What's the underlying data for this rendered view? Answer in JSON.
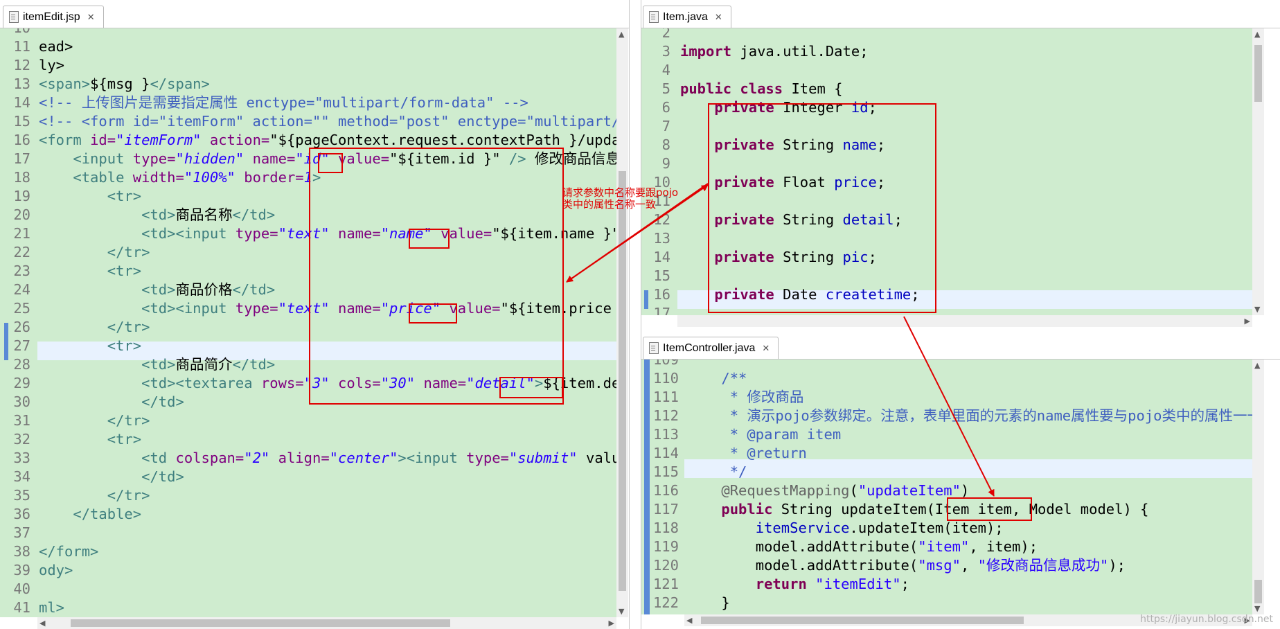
{
  "tabs": {
    "left": "itemEdit.jsp",
    "right_top": "Item.java",
    "right_bottom": "ItemController.java"
  },
  "left_editor": {
    "lines": [
      {
        "n": "10",
        "parts": []
      },
      {
        "n": "11",
        "parts": [
          [
            "pl",
            "ead>"
          ]
        ]
      },
      {
        "n": "12",
        "parts": [
          [
            "pl",
            "ly>"
          ]
        ]
      },
      {
        "n": "13",
        "parts": [
          [
            "tg",
            "<span>"
          ],
          [
            "pl",
            "${msg }"
          ],
          [
            "tg",
            "</span>"
          ]
        ]
      },
      {
        "n": "14",
        "parts": [
          [
            "cm",
            "<!-- 上传图片是需要指定属性 enctype=\"multipart/form-data\" -->"
          ]
        ]
      },
      {
        "n": "15",
        "parts": [
          [
            "cm",
            "<!-- <form id=\"itemForm\" action=\"\" method=\"post\" enctype=\"multipart/form-data\">"
          ]
        ]
      },
      {
        "n": "16",
        "parts": [
          [
            "tg",
            "<form "
          ],
          [
            "at",
            "id="
          ],
          [
            "av",
            "\"itemForm\""
          ],
          [
            "pl",
            " "
          ],
          [
            "at",
            "action="
          ],
          [
            "pl",
            "\"${pageContext.request.contextPath }/updateItem.action\" method=\"post\">"
          ]
        ]
      },
      {
        "n": "17",
        "parts": [
          [
            "pl",
            "    "
          ],
          [
            "tg",
            "<input "
          ],
          [
            "at",
            "type="
          ],
          [
            "av",
            "\"hidden\""
          ],
          [
            "pl",
            " "
          ],
          [
            "at",
            "name="
          ],
          [
            "av",
            "\"id\""
          ],
          [
            "pl",
            " "
          ],
          [
            "at",
            "value="
          ],
          [
            "pl",
            "\"${item.id }\" "
          ],
          [
            "tg",
            "/>"
          ],
          [
            "pl",
            " 修改商品信息："
          ]
        ]
      },
      {
        "n": "18",
        "parts": [
          [
            "pl",
            "    "
          ],
          [
            "tg",
            "<table "
          ],
          [
            "at",
            "width="
          ],
          [
            "av",
            "\"100%\""
          ],
          [
            "pl",
            " "
          ],
          [
            "at",
            "border="
          ],
          [
            "av",
            "1"
          ],
          [
            "tg",
            ">"
          ]
        ]
      },
      {
        "n": "19",
        "parts": [
          [
            "pl",
            "        "
          ],
          [
            "tg",
            "<tr>"
          ]
        ]
      },
      {
        "n": "20",
        "parts": [
          [
            "pl",
            "            "
          ],
          [
            "tg",
            "<td>"
          ],
          [
            "pl",
            "商品名称"
          ],
          [
            "tg",
            "</td>"
          ]
        ]
      },
      {
        "n": "21",
        "parts": [
          [
            "pl",
            "            "
          ],
          [
            "tg",
            "<td><input "
          ],
          [
            "at",
            "type="
          ],
          [
            "av",
            "\"text\""
          ],
          [
            "pl",
            " "
          ],
          [
            "at",
            "name="
          ],
          [
            "av",
            "\"name\""
          ],
          [
            "pl",
            " "
          ],
          [
            "at",
            "value="
          ],
          [
            "pl",
            "\"${item.name }\" /></td>"
          ]
        ]
      },
      {
        "n": "22",
        "parts": [
          [
            "pl",
            "        "
          ],
          [
            "tg",
            "</tr>"
          ]
        ]
      },
      {
        "n": "23",
        "parts": [
          [
            "pl",
            "        "
          ],
          [
            "tg",
            "<tr>"
          ]
        ]
      },
      {
        "n": "24",
        "parts": [
          [
            "pl",
            "            "
          ],
          [
            "tg",
            "<td>"
          ],
          [
            "pl",
            "商品价格"
          ],
          [
            "tg",
            "</td>"
          ]
        ]
      },
      {
        "n": "25",
        "parts": [
          [
            "pl",
            "            "
          ],
          [
            "tg",
            "<td><input "
          ],
          [
            "at",
            "type="
          ],
          [
            "av",
            "\"text\""
          ],
          [
            "pl",
            " "
          ],
          [
            "at",
            "name="
          ],
          [
            "av",
            "\"price\""
          ],
          [
            "pl",
            " "
          ],
          [
            "at",
            "value="
          ],
          [
            "pl",
            "\"${item.price }\" /></td>"
          ]
        ]
      },
      {
        "n": "26",
        "parts": [
          [
            "pl",
            "        "
          ],
          [
            "tg",
            "</tr>"
          ]
        ]
      },
      {
        "n": "27",
        "parts": [
          [
            "pl",
            "        "
          ],
          [
            "tg",
            "<tr>"
          ]
        ]
      },
      {
        "n": "28",
        "parts": [
          [
            "pl",
            "            "
          ],
          [
            "tg",
            "<td>"
          ],
          [
            "pl",
            "商品简介"
          ],
          [
            "tg",
            "</td>"
          ]
        ]
      },
      {
        "n": "29",
        "parts": [
          [
            "pl",
            "            "
          ],
          [
            "tg",
            "<td><textarea "
          ],
          [
            "at",
            "rows="
          ],
          [
            "av",
            "\"3\""
          ],
          [
            "pl",
            " "
          ],
          [
            "at",
            "cols="
          ],
          [
            "av",
            "\"30\""
          ],
          [
            "pl",
            " "
          ],
          [
            "at",
            "name="
          ],
          [
            "av",
            "\"detail\""
          ],
          [
            "tg",
            ">"
          ],
          [
            "pl",
            "${item.detail }</textarea>"
          ]
        ]
      },
      {
        "n": "30",
        "parts": [
          [
            "pl",
            "            "
          ],
          [
            "tg",
            "</td>"
          ]
        ]
      },
      {
        "n": "31",
        "parts": [
          [
            "pl",
            "        "
          ],
          [
            "tg",
            "</tr>"
          ]
        ]
      },
      {
        "n": "32",
        "parts": [
          [
            "pl",
            "        "
          ],
          [
            "tg",
            "<tr>"
          ]
        ]
      },
      {
        "n": "33",
        "parts": [
          [
            "pl",
            "            "
          ],
          [
            "tg",
            "<td "
          ],
          [
            "at",
            "colspan="
          ],
          [
            "av",
            "\"2\""
          ],
          [
            "pl",
            " "
          ],
          [
            "at",
            "align="
          ],
          [
            "av",
            "\"center\""
          ],
          [
            "tg",
            "><input "
          ],
          [
            "at",
            "type="
          ],
          [
            "av",
            "\"submit\""
          ],
          [
            "pl",
            " value=\"提交\" />"
          ]
        ]
      },
      {
        "n": "34",
        "parts": [
          [
            "pl",
            "            "
          ],
          [
            "tg",
            "</td>"
          ]
        ]
      },
      {
        "n": "35",
        "parts": [
          [
            "pl",
            "        "
          ],
          [
            "tg",
            "</tr>"
          ]
        ]
      },
      {
        "n": "36",
        "parts": [
          [
            "pl",
            "    "
          ],
          [
            "tg",
            "</table>"
          ]
        ]
      },
      {
        "n": "37",
        "parts": []
      },
      {
        "n": "38",
        "parts": [
          [
            "tg",
            "</form>"
          ]
        ]
      },
      {
        "n": "39",
        "parts": [
          [
            "tg",
            "ody>"
          ]
        ]
      },
      {
        "n": "40",
        "parts": []
      },
      {
        "n": "41",
        "parts": [
          [
            "tg",
            "ml>"
          ]
        ]
      }
    ]
  },
  "right_top_editor": {
    "lines": [
      {
        "n": "2",
        "parts": []
      },
      {
        "n": "3",
        "parts": [
          [
            "kw",
            "import"
          ],
          [
            "pl",
            " java.util.Date;"
          ]
        ]
      },
      {
        "n": "4",
        "parts": []
      },
      {
        "n": "5",
        "parts": [
          [
            "kw",
            "public"
          ],
          [
            "pl",
            " "
          ],
          [
            "kw",
            "class"
          ],
          [
            "pl",
            " Item {"
          ]
        ]
      },
      {
        "n": "6",
        "parts": [
          [
            "pl",
            "    "
          ],
          [
            "kw",
            "private"
          ],
          [
            "pl",
            " Integer "
          ],
          [
            "fld",
            "id"
          ],
          [
            "pl",
            ";"
          ]
        ]
      },
      {
        "n": "7",
        "parts": []
      },
      {
        "n": "8",
        "parts": [
          [
            "pl",
            "    "
          ],
          [
            "kw",
            "private"
          ],
          [
            "pl",
            " String "
          ],
          [
            "fld",
            "name"
          ],
          [
            "pl",
            ";"
          ]
        ]
      },
      {
        "n": "9",
        "parts": []
      },
      {
        "n": "10",
        "parts": [
          [
            "pl",
            "    "
          ],
          [
            "kw",
            "private"
          ],
          [
            "pl",
            " Float "
          ],
          [
            "fld",
            "price"
          ],
          [
            "pl",
            ";"
          ]
        ]
      },
      {
        "n": "11",
        "parts": []
      },
      {
        "n": "12",
        "parts": [
          [
            "pl",
            "    "
          ],
          [
            "kw",
            "private"
          ],
          [
            "pl",
            " String "
          ],
          [
            "fld",
            "detail"
          ],
          [
            "pl",
            ";"
          ]
        ]
      },
      {
        "n": "13",
        "parts": []
      },
      {
        "n": "14",
        "parts": [
          [
            "pl",
            "    "
          ],
          [
            "kw",
            "private"
          ],
          [
            "pl",
            " String "
          ],
          [
            "fld",
            "pic"
          ],
          [
            "pl",
            ";"
          ]
        ]
      },
      {
        "n": "15",
        "parts": []
      },
      {
        "n": "16",
        "parts": [
          [
            "pl",
            "    "
          ],
          [
            "kw",
            "private"
          ],
          [
            "pl",
            " Date "
          ],
          [
            "fld",
            "createtime"
          ],
          [
            "pl",
            ";"
          ]
        ]
      },
      {
        "n": "17",
        "parts": []
      }
    ]
  },
  "right_bottom_editor": {
    "lines": [
      {
        "n": "109",
        "parts": []
      },
      {
        "n": "110",
        "parts": [
          [
            "cm",
            "    /**"
          ]
        ]
      },
      {
        "n": "111",
        "parts": [
          [
            "cm",
            "     * 修改商品"
          ]
        ]
      },
      {
        "n": "112",
        "parts": [
          [
            "cm",
            "     * 演示pojo参数绑定。注意，表单里面的元素的name属性要与pojo类中的属性一一对应"
          ]
        ]
      },
      {
        "n": "113",
        "parts": [
          [
            "cm",
            "     * @param item"
          ]
        ]
      },
      {
        "n": "114",
        "parts": [
          [
            "cm",
            "     * @return"
          ]
        ]
      },
      {
        "n": "115",
        "parts": [
          [
            "cm",
            "     */"
          ]
        ]
      },
      {
        "n": "116",
        "parts": [
          [
            "ann",
            "    @RequestMapping"
          ],
          [
            "pl",
            "("
          ],
          [
            "st",
            "\"updateItem\""
          ],
          [
            "pl",
            ")"
          ]
        ]
      },
      {
        "n": "117",
        "parts": [
          [
            "pl",
            "    "
          ],
          [
            "kw",
            "public"
          ],
          [
            "pl",
            " String updateItem(Item "
          ],
          [
            "pl",
            "item"
          ],
          [
            "pl",
            ", Model "
          ],
          [
            "pl",
            "model"
          ],
          [
            "pl",
            ") {"
          ]
        ]
      },
      {
        "n": "118",
        "parts": [
          [
            "pl",
            "        "
          ],
          [
            "fld",
            "itemService"
          ],
          [
            "pl",
            ".updateItem(item);"
          ]
        ]
      },
      {
        "n": "119",
        "parts": [
          [
            "pl",
            "        model.addAttribute("
          ],
          [
            "st",
            "\"item\""
          ],
          [
            "pl",
            ", item);"
          ]
        ]
      },
      {
        "n": "120",
        "parts": [
          [
            "pl",
            "        model.addAttribute("
          ],
          [
            "st",
            "\"msg\""
          ],
          [
            "pl",
            ", "
          ],
          [
            "st",
            "\"修改商品信息成功\""
          ],
          [
            "pl",
            ");"
          ]
        ]
      },
      {
        "n": "121",
        "parts": [
          [
            "pl",
            "        "
          ],
          [
            "kw",
            "return"
          ],
          [
            "pl",
            " "
          ],
          [
            "st",
            "\"itemEdit\""
          ],
          [
            "pl",
            ";"
          ]
        ]
      },
      {
        "n": "122",
        "parts": [
          [
            "pl",
            "    }"
          ]
        ]
      }
    ]
  },
  "annotation_note": "请求参数中名称要跟pojo\n类中的属性名称一致",
  "watermark": "https://jiayun.blog.csdn.net",
  "colors": {
    "editor_bg": "#cfeccf",
    "highlight": "#e8f2fe",
    "annotation_red": "#e00000"
  }
}
